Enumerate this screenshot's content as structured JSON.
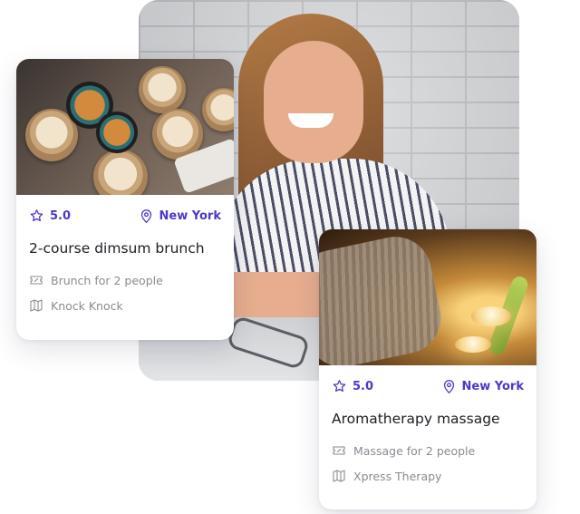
{
  "cards": [
    {
      "rating": "5.0",
      "location": "New York",
      "title": "2-course dimsum brunch",
      "offer": "Brunch for 2 people",
      "venue": "Knock Knock"
    },
    {
      "rating": "5.0",
      "location": "New York",
      "title": "Aromatherapy massage",
      "offer": "Massage for 2 people",
      "venue": "Xpress Therapy"
    }
  ],
  "colors": {
    "accent": "#4b39c8",
    "muted_text": "#8a8a92",
    "title_text": "#1d1d24"
  },
  "icons": {
    "rating": "star-badge-icon",
    "location": "map-pin-icon",
    "offer": "ticket-icon",
    "venue": "map-icon"
  }
}
